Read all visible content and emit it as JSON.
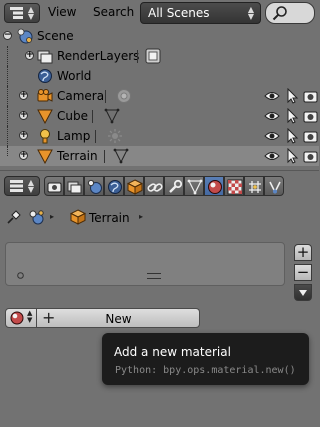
{
  "outliner": {
    "menu": [
      "View",
      "Search"
    ],
    "scene_selector": "All Scenes",
    "tree": [
      {
        "label": "Scene",
        "icon": "scene-icon"
      },
      {
        "label": "RenderLayers",
        "icon": "render-layers-icon"
      },
      {
        "label": "World",
        "icon": "world-icon"
      },
      {
        "label": "Camera",
        "icon": "camera-icon"
      },
      {
        "label": "Cube",
        "icon": "mesh-icon"
      },
      {
        "label": "Lamp",
        "icon": "lamp-icon"
      },
      {
        "label": "Terrain",
        "icon": "mesh-icon"
      }
    ],
    "selected_row": "Terrain"
  },
  "properties": {
    "breadcrumb": {
      "object": "Terrain"
    },
    "new_button_label": "New",
    "active_context": "material"
  },
  "tooltip": {
    "title": "Add a new material",
    "python": "Python: bpy.ops.material.new()"
  },
  "colors": {
    "panel_bg": "#727272",
    "selected_row": "#878787",
    "active_tab": "#5a7fb6",
    "tooltip_bg": "#1c1c1c",
    "mesh_orange": "#e8942b"
  }
}
